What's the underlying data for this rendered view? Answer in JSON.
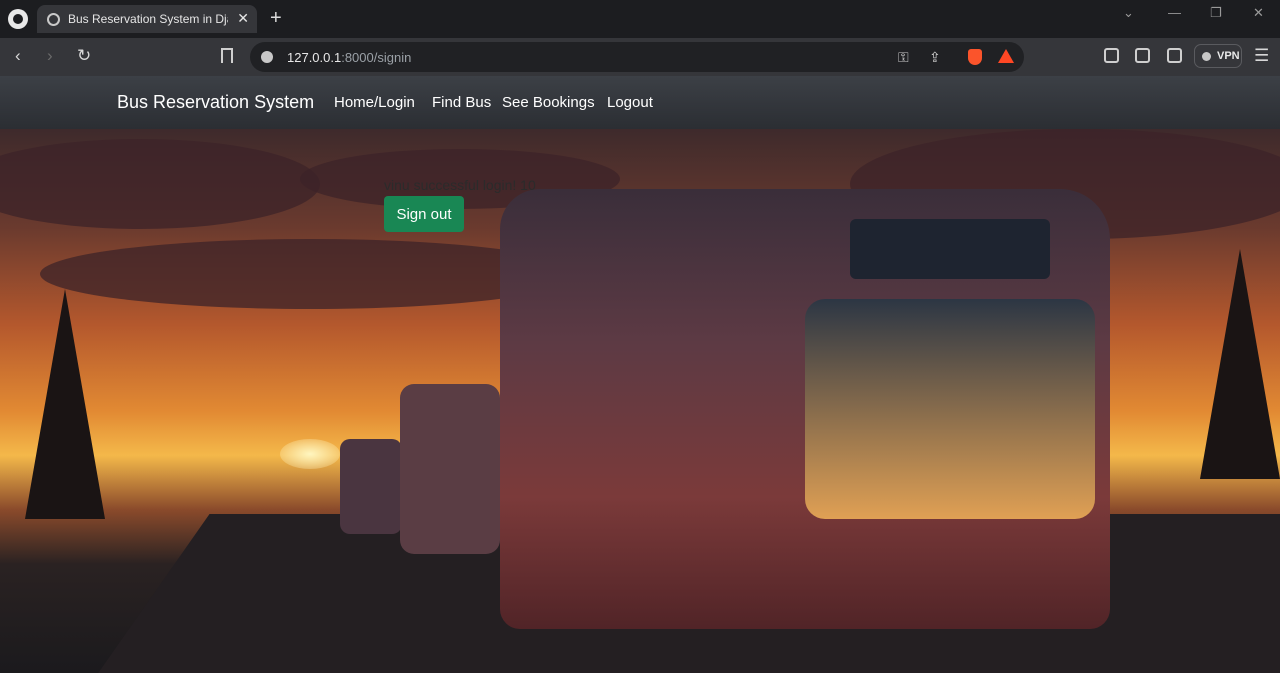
{
  "browser": {
    "tab_title": "Bus Reservation System in Django",
    "url_host": "127.0.0.1",
    "url_path": ":8000/signin",
    "vpn_label": "VPN",
    "icons": [
      "github-icon",
      "globe-icon",
      "close-icon",
      "plus-icon",
      "chevron-down-icon",
      "minimize-icon",
      "maximize-icon",
      "close-window-icon",
      "back-icon",
      "forward-icon",
      "reload-icon",
      "bookmark-icon",
      "info-icon",
      "key-icon",
      "share-icon",
      "brave-shield-icon",
      "rewards-icon",
      "extensions-icon",
      "sidebar-icon",
      "wallet-icon",
      "menu-icon"
    ]
  },
  "navbar": {
    "brand": "Bus Reservation System",
    "links": [
      "Home/Login",
      "Find Bus",
      "See Bookings",
      "Logout"
    ]
  },
  "main": {
    "message": "vinu successful login! 10",
    "signout_label": "Sign out",
    "signout_color": "#198754",
    "hero_image": "sunset-bus-illustration"
  }
}
